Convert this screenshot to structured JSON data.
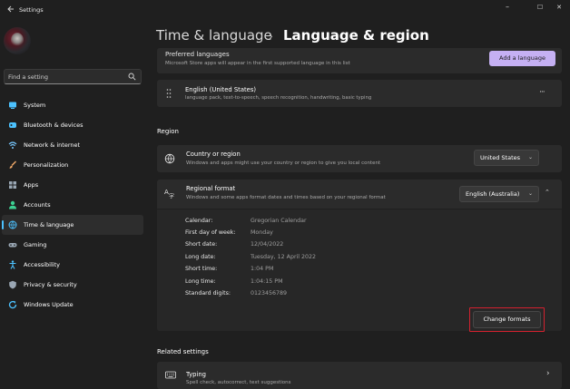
{
  "app": {
    "title": "Settings",
    "back_icon": "back-arrow-icon",
    "window_controls": {
      "minimize": "–",
      "maximize": "☐",
      "close": "✕"
    }
  },
  "sidebar": {
    "search_placeholder": "Find a setting",
    "items": [
      {
        "label": "System",
        "icon": "system-icon",
        "color": "#4cc2ff"
      },
      {
        "label": "Bluetooth & devices",
        "icon": "bluetooth-icon",
        "color": "#4cc2ff"
      },
      {
        "label": "Network & internet",
        "icon": "wifi-icon",
        "color": "#78c8ff"
      },
      {
        "label": "Personalization",
        "icon": "brush-icon",
        "color": "#f0a868"
      },
      {
        "label": "Apps",
        "icon": "apps-icon",
        "color": "#9aa7b4"
      },
      {
        "label": "Accounts",
        "icon": "accounts-icon",
        "color": "#3ccf91"
      },
      {
        "label": "Time & language",
        "icon": "globe-clock-icon",
        "color": "#4cc2ff",
        "selected": true
      },
      {
        "label": "Gaming",
        "icon": "gamepad-icon",
        "color": "#9aa7b4"
      },
      {
        "label": "Accessibility",
        "icon": "accessibility-icon",
        "color": "#4cc2ff"
      },
      {
        "label": "Privacy & security",
        "icon": "shield-icon",
        "color": "#9aa7b4"
      },
      {
        "label": "Windows Update",
        "icon": "update-icon",
        "color": "#4cc2ff"
      }
    ]
  },
  "header": {
    "breadcrumb_parent": "Time & language",
    "separator": "›",
    "breadcrumb_current": "Language & region"
  },
  "preferred": {
    "title": "Preferred languages",
    "subtitle": "Microsoft Store apps will appear in the first supported language in this list",
    "add_button": "Add a language"
  },
  "language_entry": {
    "title": "English (United States)",
    "subtitle": "language pack, text-to-speech, speech recognition, handwriting, basic typing",
    "more": "···"
  },
  "region": {
    "heading": "Region",
    "country": {
      "title": "Country or region",
      "subtitle": "Windows and apps might use your country or region to give you local content",
      "value": "United States"
    },
    "regional_format": {
      "title": "Regional format",
      "subtitle": "Windows and some apps format dates and times based on your regional format",
      "value": "English (Australia)",
      "rows": [
        {
          "label": "Calendar:",
          "value": "Gregorian Calendar"
        },
        {
          "label": "First day of week:",
          "value": "Monday"
        },
        {
          "label": "Short date:",
          "value": "12/04/2022"
        },
        {
          "label": "Long date:",
          "value": "Tuesday, 12 April 2022"
        },
        {
          "label": "Short time:",
          "value": "1:04 PM"
        },
        {
          "label": "Long time:",
          "value": "1:04:15 PM"
        },
        {
          "label": "Standard digits:",
          "value": "0123456789"
        }
      ],
      "change_button": "Change formats",
      "highlight_color": "#d4212f"
    }
  },
  "related": {
    "heading": "Related settings",
    "typing": {
      "title": "Typing",
      "subtitle": "Spell check, autocorrect, text suggestions"
    }
  },
  "colors": {
    "background": "#1f1f1f",
    "card": "#2b2b2b",
    "accent": "#4cc2ff",
    "add_language_button": "#c5b0f3"
  }
}
